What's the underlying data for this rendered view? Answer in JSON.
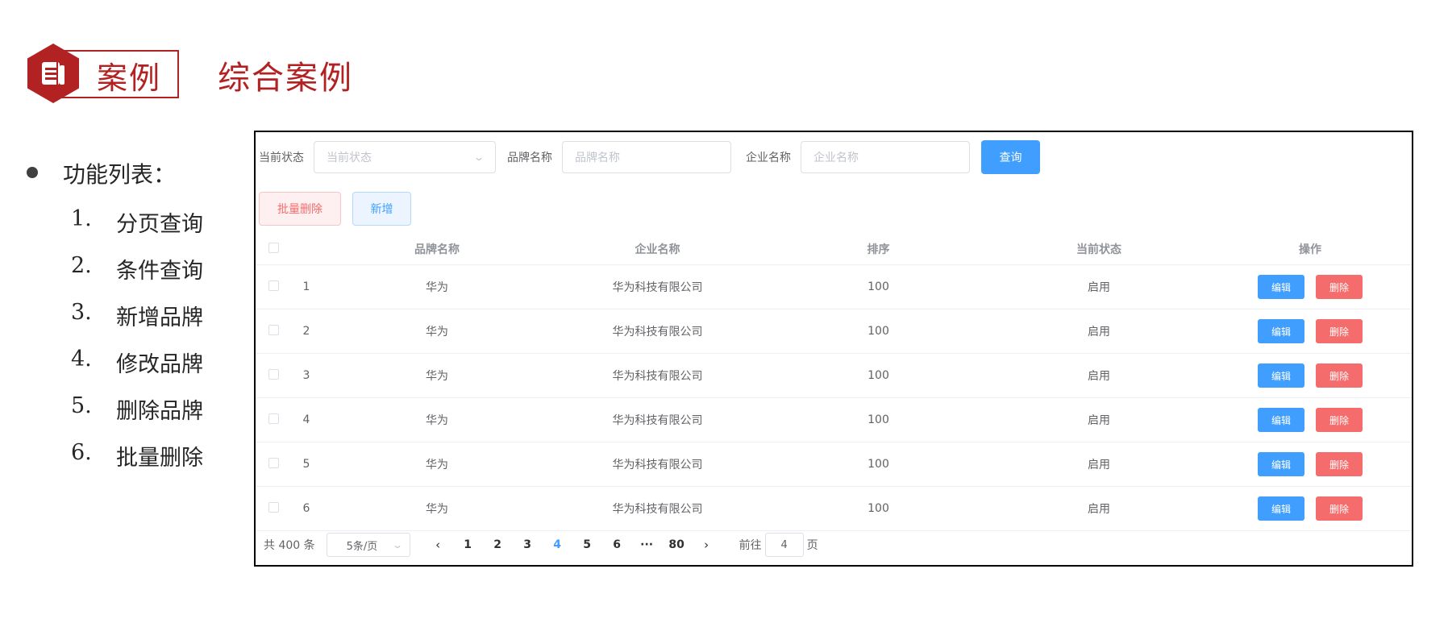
{
  "slide": {
    "tag": "案例",
    "title": "综合案例",
    "feature_heading": "功能列表：",
    "features": [
      {
        "num": "1.",
        "text": "分页查询"
      },
      {
        "num": "2.",
        "text": "条件查询"
      },
      {
        "num": "3.",
        "text": "新增品牌"
      },
      {
        "num": "4.",
        "text": "修改品牌"
      },
      {
        "num": "5.",
        "text": "删除品牌"
      },
      {
        "num": "6.",
        "text": "批量删除"
      }
    ]
  },
  "search": {
    "status_label": "当前状态",
    "status_placeholder": "当前状态",
    "brand_label": "品牌名称",
    "brand_placeholder": "品牌名称",
    "company_label": "企业名称",
    "company_placeholder": "企业名称",
    "query_button": "查询"
  },
  "actions": {
    "batch_delete": "批量删除",
    "add": "新增"
  },
  "table": {
    "columns": [
      "品牌名称",
      "企业名称",
      "排序",
      "当前状态",
      "操作"
    ],
    "rows": [
      {
        "index": "1",
        "brand": "华为",
        "company": "华为科技有限公司",
        "order": "100",
        "status": "启用",
        "edit": "编辑",
        "delete": "删除"
      },
      {
        "index": "2",
        "brand": "华为",
        "company": "华为科技有限公司",
        "order": "100",
        "status": "启用",
        "edit": "编辑",
        "delete": "删除"
      },
      {
        "index": "3",
        "brand": "华为",
        "company": "华为科技有限公司",
        "order": "100",
        "status": "启用",
        "edit": "编辑",
        "delete": "删除"
      },
      {
        "index": "4",
        "brand": "华为",
        "company": "华为科技有限公司",
        "order": "100",
        "status": "启用",
        "edit": "编辑",
        "delete": "删除"
      },
      {
        "index": "5",
        "brand": "华为",
        "company": "华为科技有限公司",
        "order": "100",
        "status": "启用",
        "edit": "编辑",
        "delete": "删除"
      },
      {
        "index": "6",
        "brand": "华为",
        "company": "华为科技有限公司",
        "order": "100",
        "status": "启用",
        "edit": "编辑",
        "delete": "删除"
      }
    ]
  },
  "pagination": {
    "total": "共 400 条",
    "page_size": "5条/页",
    "prev": "‹",
    "next": "›",
    "pages": [
      "1",
      "2",
      "3",
      "4",
      "5",
      "6",
      "···",
      "80"
    ],
    "current": "4",
    "goto_label": "前往",
    "goto_value": "4",
    "goto_suffix": "页"
  },
  "colors": {
    "accent": "#b22222",
    "primary": "#409eff",
    "danger": "#f56c6c"
  }
}
